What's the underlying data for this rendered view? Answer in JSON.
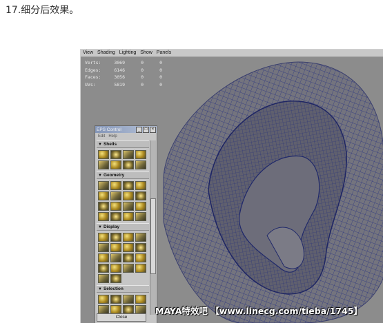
{
  "caption": "17.细分后效果。",
  "viewport": {
    "menu": [
      "View",
      "Shading",
      "Lighting",
      "Show",
      "Panels"
    ],
    "hud": [
      {
        "label": "Verts:",
        "v1": "3069",
        "v2": "0",
        "v3": "0"
      },
      {
        "label": "Edges:",
        "v1": "6146",
        "v2": "0",
        "v3": "0"
      },
      {
        "label": "Faces:",
        "v1": "3056",
        "v2": "0",
        "v3": "0"
      },
      {
        "label": "UVs:",
        "v1": "5819",
        "v2": "0",
        "v3": "0"
      }
    ]
  },
  "panel": {
    "title": "EPS Control",
    "menu": [
      "Edit",
      "Help"
    ],
    "sections": [
      "Shells",
      "Geometry",
      "Display",
      "Selection"
    ],
    "close_label": "Close"
  },
  "watermark": "MAYA特效吧 【www.linecg.com/tieba/1745】",
  "colors": {
    "viewport_bg": "#8c8c8c",
    "mesh_wire": "#2a3480",
    "panel_bg": "#c6c6c6"
  }
}
